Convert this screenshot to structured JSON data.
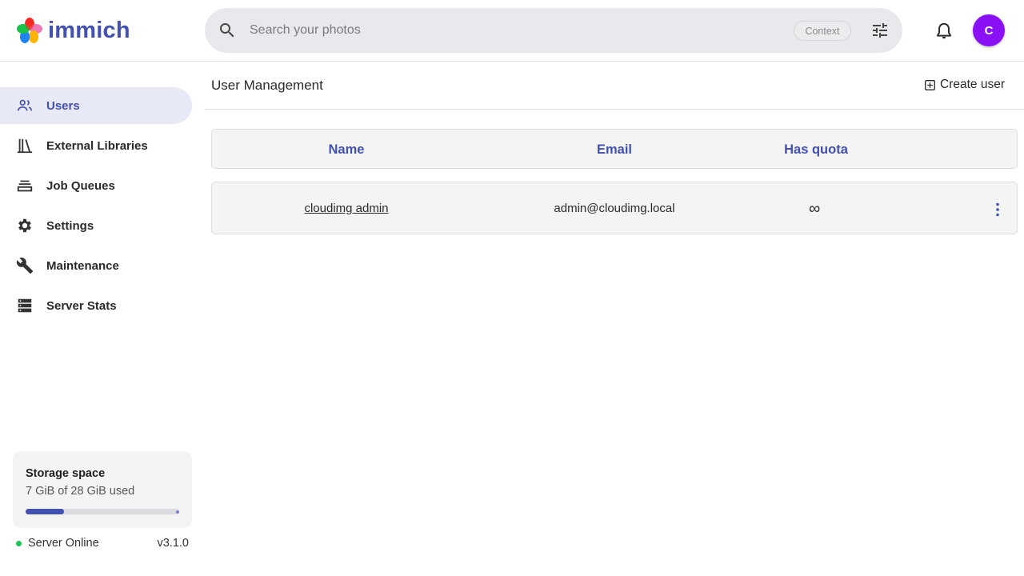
{
  "app": {
    "name": "immich"
  },
  "search": {
    "placeholder": "Search your photos",
    "context_chip": "Context"
  },
  "user": {
    "avatar_initial": "C",
    "avatar_color": "#8a11f6"
  },
  "sidebar": {
    "items": [
      {
        "label": "Users",
        "icon": "users-icon",
        "active": true
      },
      {
        "label": "External Libraries",
        "icon": "library-icon",
        "active": false
      },
      {
        "label": "Job Queues",
        "icon": "job-queue-icon",
        "active": false
      },
      {
        "label": "Settings",
        "icon": "gear-icon",
        "active": false
      },
      {
        "label": "Maintenance",
        "icon": "wrench-icon",
        "active": false
      },
      {
        "label": "Server Stats",
        "icon": "server-icon",
        "active": false
      }
    ],
    "storage": {
      "title": "Storage space",
      "usage": "7 GiB of 28 GiB used",
      "used_fraction": 0.25
    },
    "server": {
      "status": "Server Online",
      "version": "v3.1.0"
    }
  },
  "main": {
    "title": "User Management",
    "create_label": "Create user",
    "table": {
      "headers": [
        "Name",
        "Email",
        "Has quota"
      ],
      "rows": [
        {
          "name": "cloudimg admin",
          "email": "admin@cloudimg.local",
          "quota": "∞"
        }
      ]
    }
  },
  "colors": {
    "accent": "#4250af",
    "online": "#1ec25a",
    "active_bg": "#e7e9f7"
  }
}
